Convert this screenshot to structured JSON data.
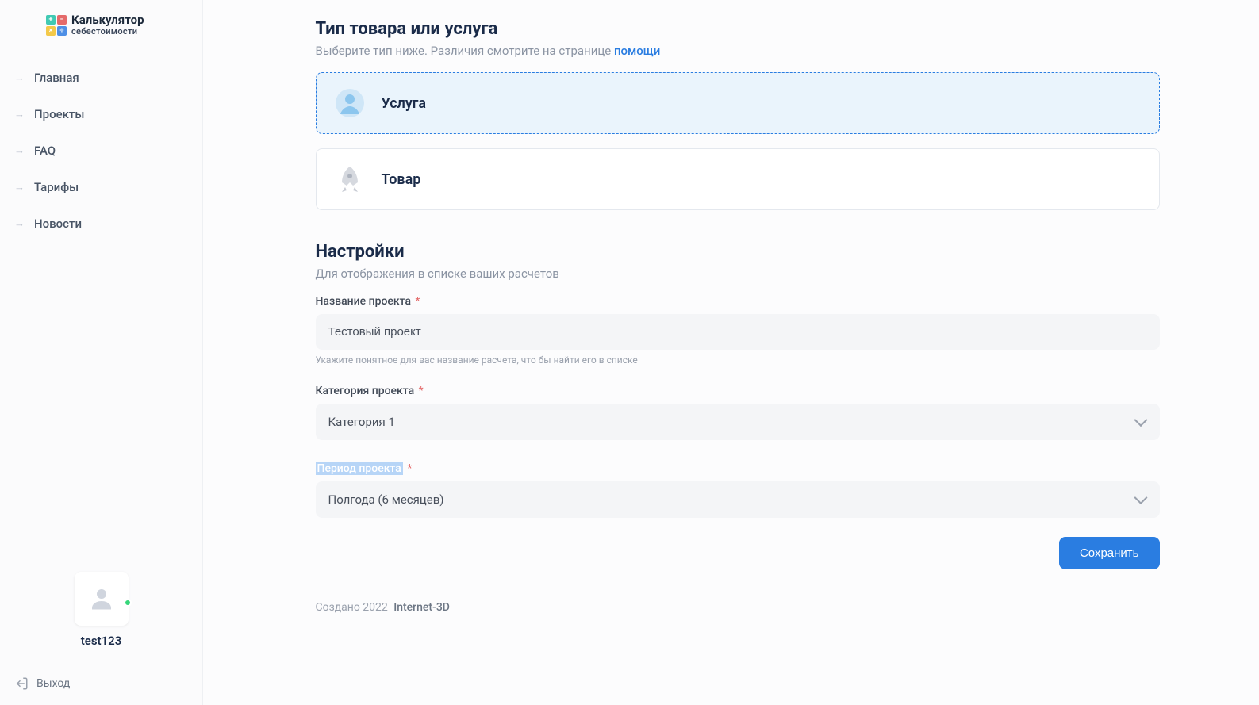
{
  "logo": {
    "line1": "Калькулятор",
    "line2": "себестоимости"
  },
  "sidebar": {
    "items": [
      {
        "label": "Главная"
      },
      {
        "label": "Проекты"
      },
      {
        "label": "FAQ"
      },
      {
        "label": "Тарифы"
      },
      {
        "label": "Новости"
      }
    ]
  },
  "user": {
    "name": "test123"
  },
  "logout_label": "Выход",
  "type_section": {
    "title": "Тип товара или услуга",
    "subtitle_prefix": "Выберите тип ниже. Различия смотрите на странице ",
    "help_link": "помощи",
    "options": [
      {
        "label": "Услуга"
      },
      {
        "label": "Товар"
      }
    ]
  },
  "settings": {
    "title": "Настройки",
    "subtitle": "Для отображения в списке ваших расчетов",
    "name_label": "Название проекта",
    "name_value": "Тестовый проект",
    "name_hint": "Укажите понятное для вас название расчета, что бы найти его в списке",
    "category_label": "Категория проекта",
    "category_value": "Категория 1",
    "period_label": "Период проекта",
    "period_value": "Полгода (6 месяцев)"
  },
  "save_label": "Сохранить",
  "footer": {
    "created": "Создано 2022",
    "brand": "Internet-3D"
  },
  "required_mark": "*"
}
